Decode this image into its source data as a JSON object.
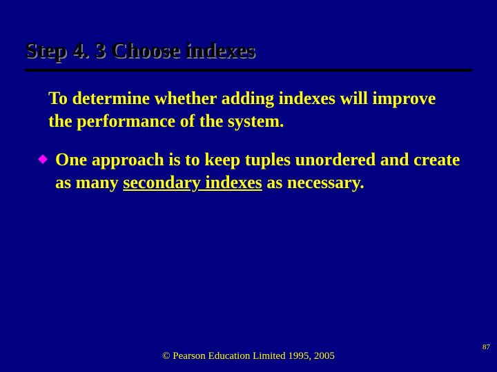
{
  "slide": {
    "title": "Step 4. 3  Choose indexes",
    "para1": "To determine whether adding indexes will improve the performance of the system.",
    "bullet_prefix": "One approach is to keep tuples unordered and create as many ",
    "bullet_underlined": "secondary indexes",
    "bullet_suffix": " as necessary.",
    "footer": "© Pearson Education Limited 1995, 2005",
    "page_number": "87"
  }
}
